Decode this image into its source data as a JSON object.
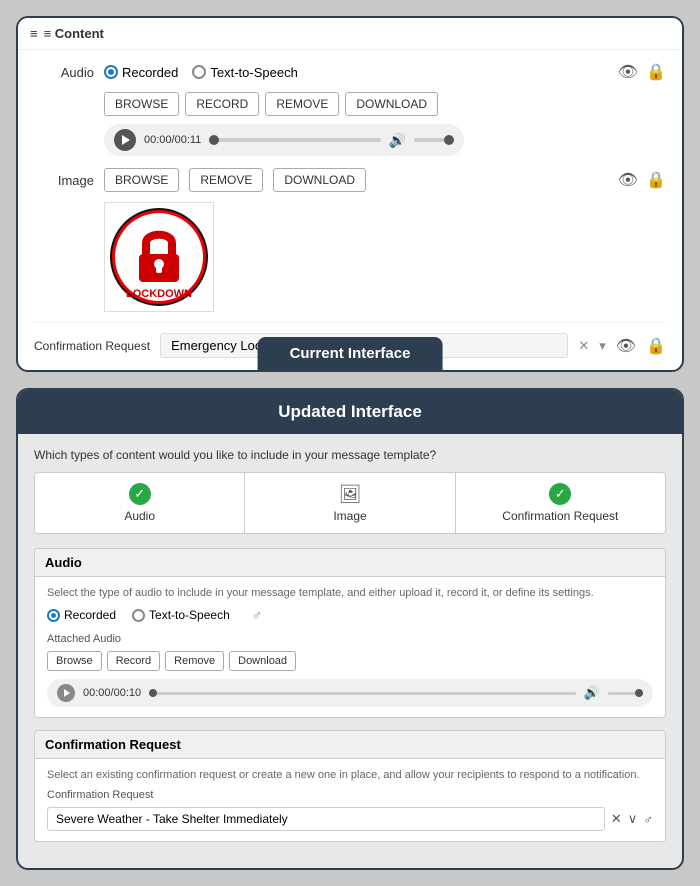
{
  "current": {
    "header": "≡ Content",
    "audio_label": "Audio",
    "radio_recorded": "Recorded",
    "radio_tts": "Text-to-Speech",
    "btn_browse": "BROWSE",
    "btn_record": "RECORD",
    "btn_remove": "REMOVE",
    "btn_download": "DOWNLOAD",
    "time": "00:00/00:11",
    "image_label": "Image",
    "img_btn_browse": "BROWSE",
    "img_btn_remove": "REMOVE",
    "img_btn_download": "DOWNLOAD",
    "lockdown_text": "LOCKDOWN",
    "confirmation_label": "Confirmation Request",
    "confirmation_value": "Emergency Lockdown",
    "badge": "Current Interface"
  },
  "updated": {
    "header": "Updated Interface",
    "question": "Which types of content would you like to include in your message template?",
    "type_audio": "Audio",
    "type_image": "Image",
    "type_confirmation": "Confirmation Request",
    "audio_section_title": "Audio",
    "audio_desc": "Select the type of audio to include in your message template, and either upload it, record it, or define its settings.",
    "radio_recorded": "Recorded",
    "radio_tts": "Text-to-Speech",
    "attached_label": "Attached Audio",
    "btn_browse": "Browse",
    "btn_record": "Record",
    "btn_remove": "Remove",
    "btn_download": "Download",
    "time": "00:00/00:10",
    "cf_section_title": "Confirmation Request",
    "cf_desc": "Select an existing confirmation request or create a new one in place, and allow your recipients to respond to a notification.",
    "cf_label": "Confirmation Request",
    "cf_value": "Severe Weather - Take Shelter Immediately"
  }
}
